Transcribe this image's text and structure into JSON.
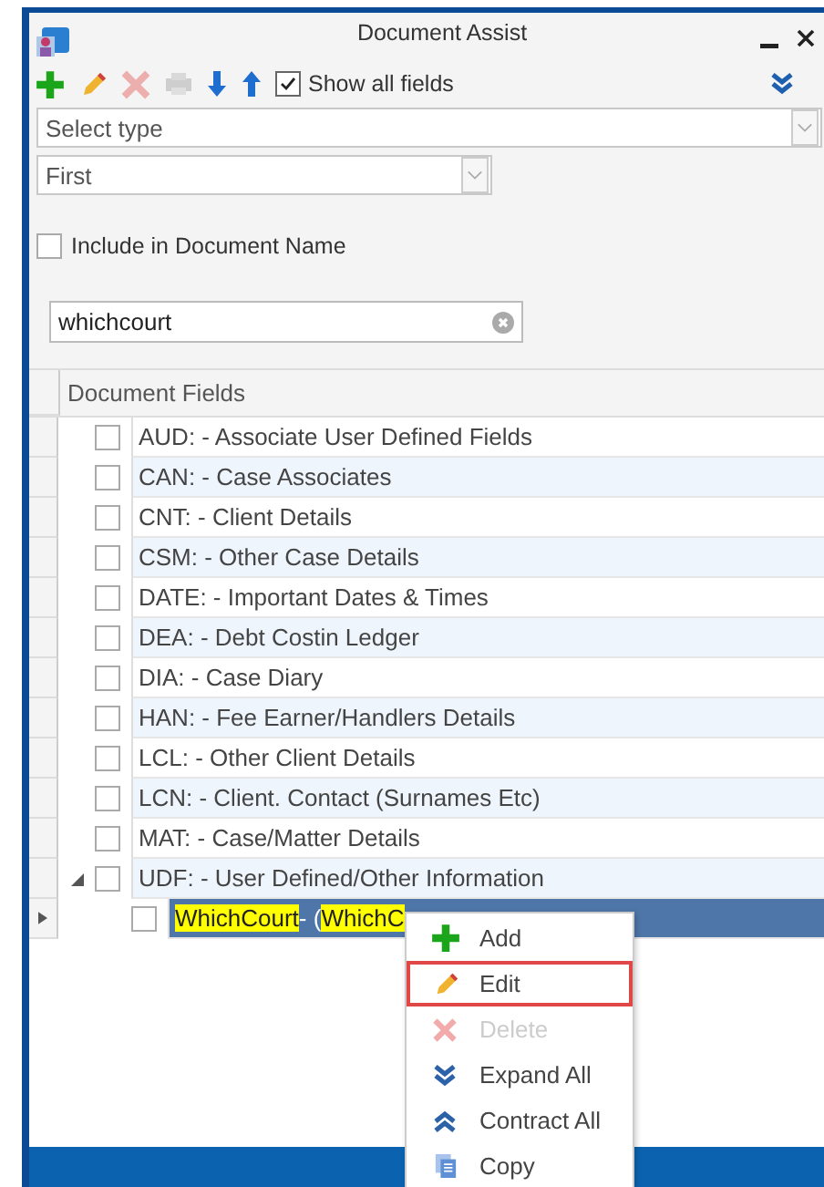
{
  "window": {
    "title": "Document Assist"
  },
  "toolbar": {
    "buttons": [
      {
        "kind": "add",
        "disabled": false
      },
      {
        "kind": "edit",
        "disabled": false
      },
      {
        "kind": "delete",
        "disabled": true
      },
      {
        "kind": "print",
        "disabled": true
      },
      {
        "kind": "down",
        "disabled": false
      },
      {
        "kind": "up",
        "disabled": false
      }
    ],
    "show_all_fields": {
      "label": "Show all fields",
      "checked": true
    }
  },
  "type_select": {
    "placeholder": "Select type"
  },
  "position_select": {
    "value": "First"
  },
  "include_in_name": {
    "label": "Include in Document Name",
    "checked": false
  },
  "search": {
    "value": "whichcourt"
  },
  "tree": {
    "header": "Document Fields",
    "rows": [
      {
        "label": "AUD:  - Associate User Defined Fields",
        "checked": false
      },
      {
        "label": "CAN:  - Case Associates",
        "checked": false
      },
      {
        "label": "CNT:  - Client Details",
        "checked": false
      },
      {
        "label": "CSM:  - Other Case Details",
        "checked": false
      },
      {
        "label": "DATE: - Important Dates & Times",
        "checked": false
      },
      {
        "label": "DEA:  - Debt Costin Ledger",
        "checked": false
      },
      {
        "label": "DIA:  - Case Diary",
        "checked": false
      },
      {
        "label": "HAN:  - Fee Earner/Handlers Details",
        "checked": false
      },
      {
        "label": "LCL:  - Other Client Details",
        "checked": false
      },
      {
        "label": "LCN:  - Client. Contact (Surnames Etc)",
        "checked": false
      },
      {
        "label": "MAT:  - Case/Matter Details",
        "checked": false
      },
      {
        "label": "UDF:  - User Defined/Other Information",
        "checked": false,
        "expanded": true,
        "children": [
          {
            "segments": [
              {
                "text": "WhichCourt",
                "highlight": true
              },
              {
                "text": "- (",
                "highlight": false
              },
              {
                "text": "WhichC",
                "highlight": true
              }
            ],
            "checked": false,
            "selected": true
          }
        ]
      }
    ]
  },
  "context_menu": [
    {
      "kind": "add",
      "label": "Add",
      "disabled": false,
      "outlined": false
    },
    {
      "kind": "edit",
      "label": "Edit",
      "disabled": false,
      "outlined": true
    },
    {
      "kind": "delete",
      "label": "Delete",
      "disabled": true,
      "outlined": false
    },
    {
      "kind": "expand",
      "label": "Expand All",
      "disabled": false,
      "outlined": false
    },
    {
      "kind": "contract",
      "label": "Contract All",
      "disabled": false,
      "outlined": false
    },
    {
      "kind": "copy",
      "label": "Copy",
      "disabled": false,
      "outlined": false
    }
  ]
}
